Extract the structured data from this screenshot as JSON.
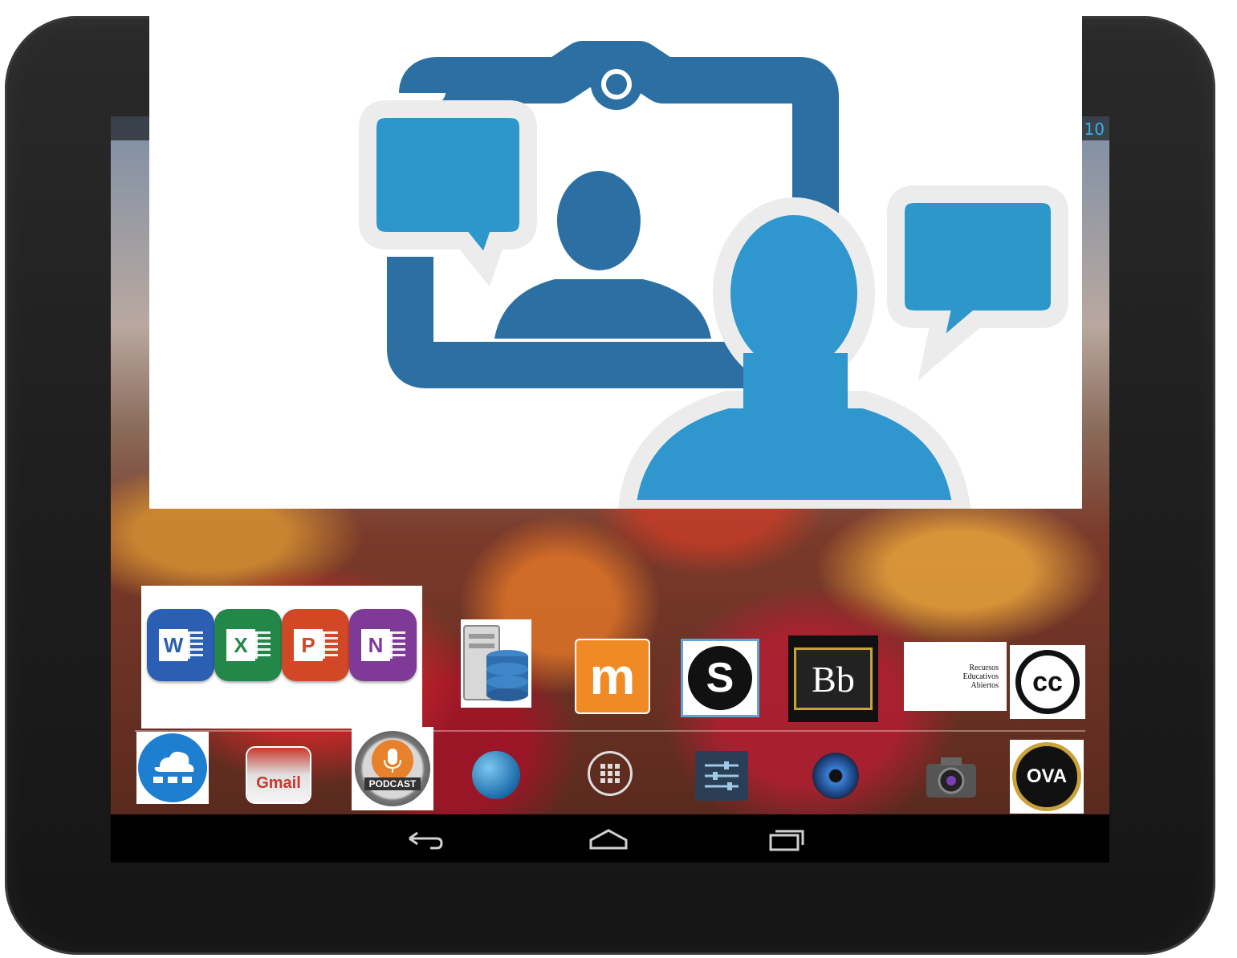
{
  "status_bar": {
    "clock": "10"
  },
  "banner": {
    "colors": {
      "frame": "#2b6fa3",
      "bubble": "#2d97cc",
      "person": "#2f97ce"
    }
  },
  "apps_row1": [
    {
      "name": "Word",
      "letter": "W",
      "color": "#2b5fb4"
    },
    {
      "name": "Excel",
      "letter": "X",
      "color": "#23874a"
    },
    {
      "name": "PowerPoint",
      "letter": "P",
      "color": "#d24726"
    },
    {
      "name": "OneNote",
      "letter": "N",
      "color": "#7e3a96"
    }
  ],
  "moodle": {
    "letter": "m",
    "color": "#f08a24"
  },
  "schoology": {
    "letter": "S"
  },
  "blackboard": {
    "letter": "Bb"
  },
  "rea": {
    "lines": [
      "Recursos",
      "Educativos",
      "Abiertos"
    ]
  },
  "cc": {
    "letter": "cc"
  },
  "gmail": {
    "label": "Gmail"
  },
  "podcast": {
    "label": "PODCAST"
  },
  "ova": {
    "label": "OVA"
  },
  "icons": {
    "cloud": "cloud-network-icon",
    "server": "database-server-icon",
    "browser": "globe-icon",
    "app_drawer": "app-drawer-icon",
    "settings": "settings-sliders-icon",
    "music": "speaker-icon",
    "camera": "camera-icon",
    "back": "back-icon",
    "home": "home-icon",
    "recents": "recents-icon"
  }
}
